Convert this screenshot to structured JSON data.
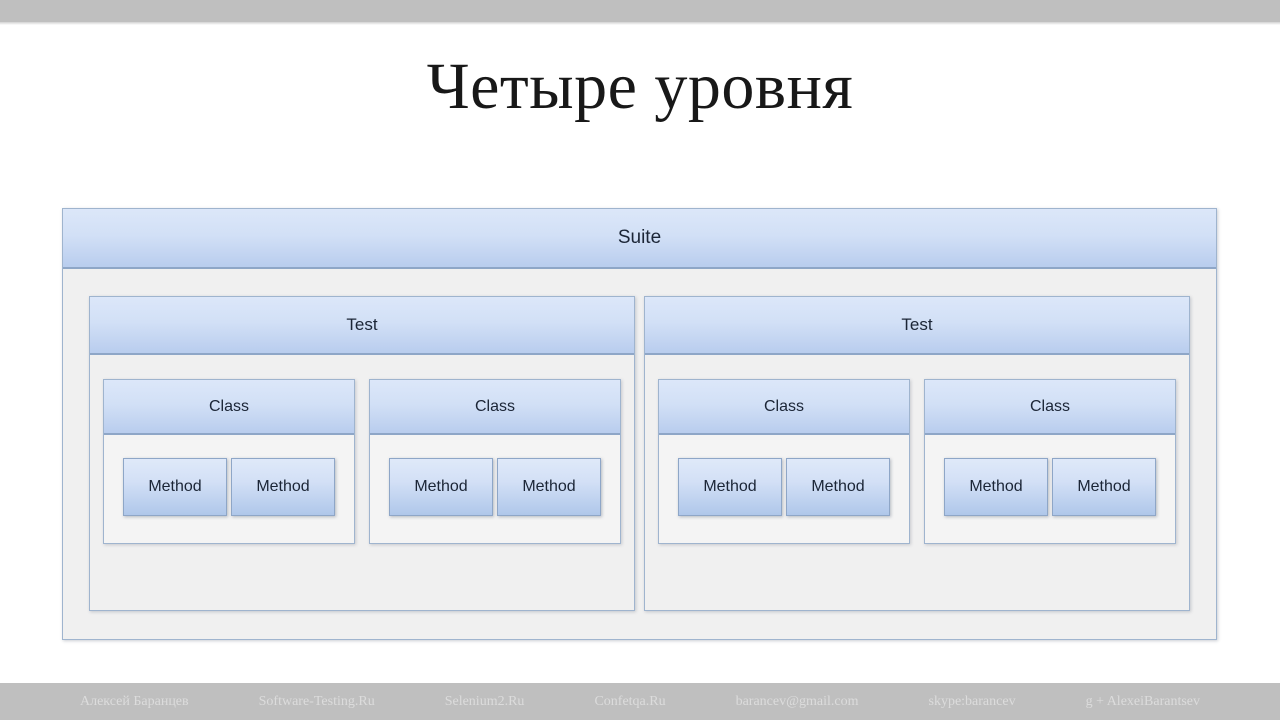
{
  "slide": {
    "title": "Четыре уровня",
    "background_color": "#ffffff",
    "band_color": "#bfbfbf"
  },
  "diagram": {
    "type": "nesting-hierarchy",
    "accent_color": "#b9cdee",
    "border_color": "#9fb4ce",
    "suite": {
      "label": "Suite",
      "tests": [
        {
          "label": "Test",
          "classes": [
            {
              "label": "Class",
              "methods": [
                {
                  "label": "Method"
                },
                {
                  "label": "Method"
                }
              ]
            },
            {
              "label": "Class",
              "methods": [
                {
                  "label": "Method"
                },
                {
                  "label": "Method"
                }
              ]
            }
          ]
        },
        {
          "label": "Test",
          "classes": [
            {
              "label": "Class",
              "methods": [
                {
                  "label": "Method"
                },
                {
                  "label": "Method"
                }
              ]
            },
            {
              "label": "Class",
              "methods": [
                {
                  "label": "Method"
                },
                {
                  "label": "Method"
                }
              ]
            }
          ]
        }
      ]
    }
  },
  "footer": {
    "items": [
      "Алексей Баранцев",
      "Software-Testing.Ru",
      "Selenium2.Ru",
      "Confetqa.Ru",
      "barancev@gmail.com",
      "skype:barancev",
      "g + AlexeiBarantsev"
    ]
  }
}
